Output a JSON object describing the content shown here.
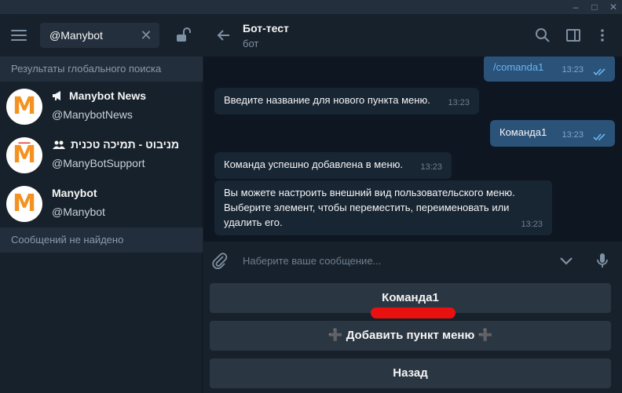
{
  "window": {
    "min": "–",
    "max": "□",
    "close": "✕"
  },
  "search": {
    "value": "@Manybot"
  },
  "left": {
    "global_results_header": "Результаты глобального поиска",
    "results": [
      {
        "title": "Manybot News",
        "handle": "@ManybotNews",
        "icon": "megaphone-icon"
      },
      {
        "title": "מניבוט - תמיכה טכנית",
        "handle": "@ManyBotSupport",
        "icon": "group-icon"
      },
      {
        "title": "Manybot",
        "handle": "@Manybot",
        "icon": ""
      }
    ],
    "no_messages": "Сообщений не найдено",
    "avatar_letter": "M"
  },
  "chat": {
    "title": "Бот-тест",
    "status": "бот",
    "messages": [
      {
        "dir": "out",
        "text": "/comanda1",
        "time": "13:23"
      },
      {
        "dir": "in",
        "text": "Введите название для нового пункта меню.",
        "time": "13:23"
      },
      {
        "dir": "out",
        "text": "Команда1",
        "time": "13:23"
      },
      {
        "dir": "in",
        "text": "Команда успешно добавлена в меню.",
        "time": "13:23"
      },
      {
        "dir": "in",
        "lines": [
          "Вы можете настроить внешний вид пользовательского меню.",
          "Выберите элемент, чтобы переместить, переименовать или",
          "удалить его."
        ],
        "time": "13:23"
      }
    ],
    "composer_placeholder": "Наберите ваше сообщение..."
  },
  "keyboard": {
    "buttons": [
      "Команда1",
      "➕ Добавить пункт меню ➕",
      "Назад"
    ]
  },
  "colors": {
    "bg": "#17212b",
    "chat_bg": "#0e1621",
    "in_bubble": "#182533",
    "out_bubble": "#2b5278",
    "accent": "#6ab3f3",
    "annotation": "#e8110f"
  }
}
